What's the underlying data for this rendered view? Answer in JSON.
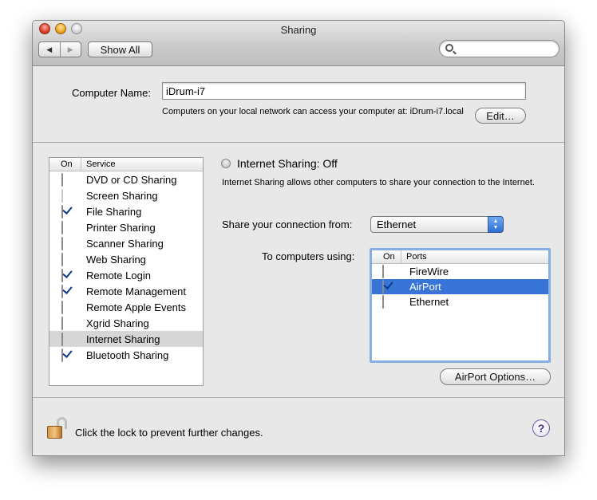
{
  "window": {
    "title": "Sharing"
  },
  "toolbar": {
    "back_label": "◀",
    "forward_label": "▶",
    "show_all_label": "Show All",
    "search_placeholder": ""
  },
  "computer_name": {
    "label": "Computer Name:",
    "value": "iDrum-i7",
    "help_text": "Computers on your local network can access your computer at: iDrum-i7.local",
    "edit_label": "Edit…"
  },
  "service_list": {
    "headers": {
      "on": "On",
      "service": "Service"
    },
    "items": [
      {
        "label": "DVD or CD Sharing",
        "checked": false
      },
      {
        "label": "Screen Sharing",
        "checked": false
      },
      {
        "label": "File Sharing",
        "checked": true
      },
      {
        "label": "Printer Sharing",
        "checked": false
      },
      {
        "label": "Scanner Sharing",
        "checked": false
      },
      {
        "label": "Web Sharing",
        "checked": false
      },
      {
        "label": "Remote Login",
        "checked": true
      },
      {
        "label": "Remote Management",
        "checked": true
      },
      {
        "label": "Remote Apple Events",
        "checked": false
      },
      {
        "label": "Xgrid Sharing",
        "checked": false
      },
      {
        "label": "Internet Sharing",
        "checked": false,
        "selected": true
      },
      {
        "label": "Bluetooth Sharing",
        "checked": true
      }
    ]
  },
  "detail": {
    "status": "Internet Sharing: Off",
    "description": "Internet Sharing allows other computers to share your connection to the Internet.",
    "share_from_label": "Share your connection from:",
    "share_from_value": "Ethernet",
    "to_computers_label": "To computers using:",
    "ports_headers": {
      "on": "On",
      "ports": "Ports"
    },
    "ports": [
      {
        "label": "FireWire",
        "checked": false
      },
      {
        "label": "AirPort",
        "checked": true,
        "selected": true
      },
      {
        "label": "Ethernet",
        "checked": false
      }
    ],
    "airport_options_label": "AirPort Options…"
  },
  "footer": {
    "lock_text": "Click the lock to prevent further changes.",
    "help_label": "?"
  },
  "colors": {
    "selection": "#3875d7",
    "focus_ring": "#86aee4"
  }
}
